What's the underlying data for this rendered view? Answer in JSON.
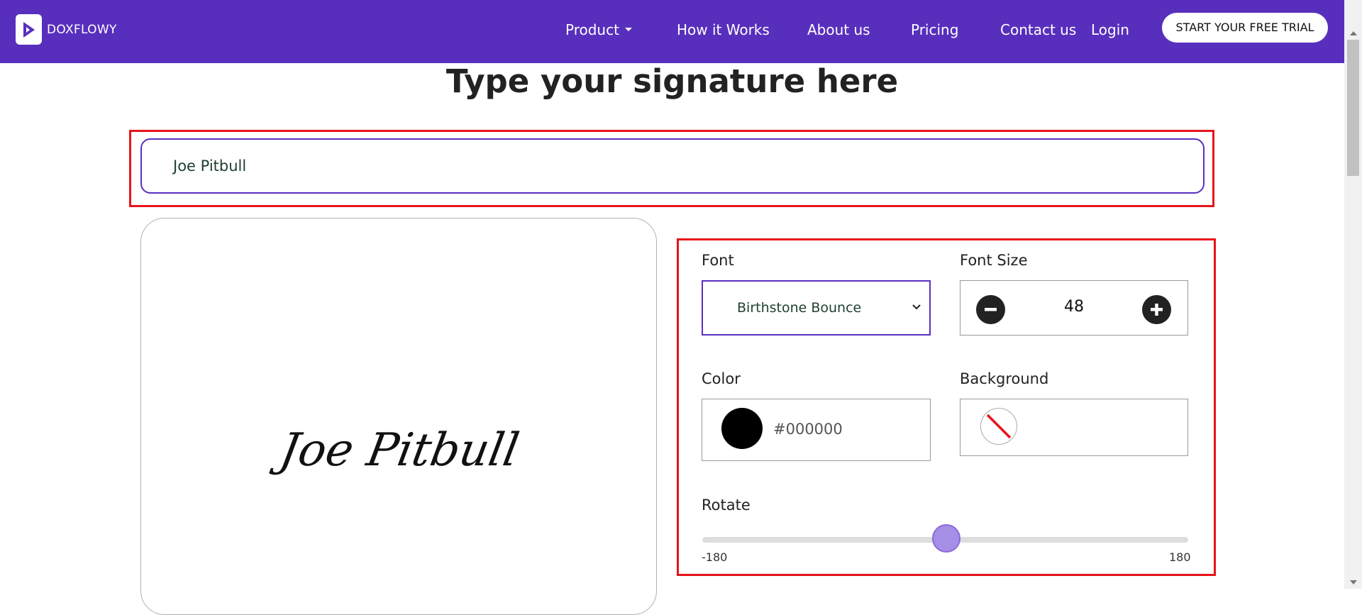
{
  "header": {
    "logo_text": "DOXFLOWY",
    "nav": {
      "product": "Product",
      "how_it_works": "How it Works",
      "about_us": "About us",
      "pricing": "Pricing",
      "contact_us": "Contact us",
      "login": "Login"
    },
    "trial_button": "START YOUR FREE TRIAL"
  },
  "page_title": "Type your signature here",
  "signature_input": {
    "value": "Joe Pitbull"
  },
  "preview": {
    "signature_text": "Joe Pitbull"
  },
  "options": {
    "font": {
      "label": "Font",
      "selected": "Birthstone Bounce"
    },
    "font_size": {
      "label": "Font Size",
      "value": "48"
    },
    "color": {
      "label": "Color",
      "value": "#000000"
    },
    "background": {
      "label": "Background",
      "value": "none"
    },
    "rotate": {
      "label": "Rotate",
      "min": "-180",
      "max": "180",
      "value": 0
    }
  },
  "colors": {
    "brand": "#582fbd",
    "highlight_border": "#e8141b",
    "slider_thumb": "#a58ee6"
  }
}
